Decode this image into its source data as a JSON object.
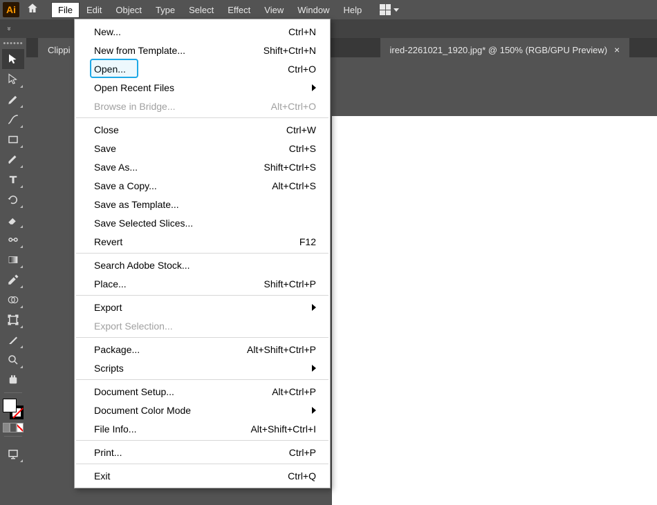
{
  "app_logo_text": "Ai",
  "menus": {
    "file": "File",
    "edit": "Edit",
    "object": "Object",
    "type": "Type",
    "select": "Select",
    "effect": "Effect",
    "view": "View",
    "window": "Window",
    "help": "Help"
  },
  "tab": {
    "title_left": "Clippi",
    "title_right": "ired-2261021_1920.jpg* @ 150% (RGB/GPU Preview)"
  },
  "file_menu": {
    "groups": [
      [
        {
          "label": "New...",
          "shortcut": "Ctrl+N",
          "sub": false
        },
        {
          "label": "New from Template...",
          "shortcut": "Shift+Ctrl+N",
          "sub": false
        },
        {
          "label": "Open...",
          "shortcut": "Ctrl+O",
          "sub": false,
          "highlight": true
        },
        {
          "label": "Open Recent Files",
          "shortcut": "",
          "sub": true
        },
        {
          "label": "Browse in Bridge...",
          "shortcut": "Alt+Ctrl+O",
          "sub": false,
          "disabled": true
        }
      ],
      [
        {
          "label": "Close",
          "shortcut": "Ctrl+W",
          "sub": false
        },
        {
          "label": "Save",
          "shortcut": "Ctrl+S",
          "sub": false
        },
        {
          "label": "Save As...",
          "shortcut": "Shift+Ctrl+S",
          "sub": false
        },
        {
          "label": "Save a Copy...",
          "shortcut": "Alt+Ctrl+S",
          "sub": false
        },
        {
          "label": "Save as Template...",
          "shortcut": "",
          "sub": false
        },
        {
          "label": "Save Selected Slices...",
          "shortcut": "",
          "sub": false
        },
        {
          "label": "Revert",
          "shortcut": "F12",
          "sub": false
        }
      ],
      [
        {
          "label": "Search Adobe Stock...",
          "shortcut": "",
          "sub": false
        },
        {
          "label": "Place...",
          "shortcut": "Shift+Ctrl+P",
          "sub": false
        }
      ],
      [
        {
          "label": "Export",
          "shortcut": "",
          "sub": true
        },
        {
          "label": "Export Selection...",
          "shortcut": "",
          "sub": false,
          "disabled": true
        }
      ],
      [
        {
          "label": "Package...",
          "shortcut": "Alt+Shift+Ctrl+P",
          "sub": false
        },
        {
          "label": "Scripts",
          "shortcut": "",
          "sub": true
        }
      ],
      [
        {
          "label": "Document Setup...",
          "shortcut": "Alt+Ctrl+P",
          "sub": false
        },
        {
          "label": "Document Color Mode",
          "shortcut": "",
          "sub": true
        },
        {
          "label": "File Info...",
          "shortcut": "Alt+Shift+Ctrl+I",
          "sub": false
        }
      ],
      [
        {
          "label": "Print...",
          "shortcut": "Ctrl+P",
          "sub": false
        }
      ],
      [
        {
          "label": "Exit",
          "shortcut": "Ctrl+Q",
          "sub": false
        }
      ]
    ]
  },
  "tools": [
    "selection-tool",
    "direct-selection-tool",
    "pen-tool",
    "curvature-tool",
    "rectangle-tool",
    "paintbrush-tool",
    "type-tool",
    "rotate-tool",
    "eraser-tool",
    "width-tool",
    "gradient-tool",
    "eyedropper-tool",
    "blend-tool",
    "artboard-tool",
    "slice-tool",
    "zoom-tool",
    "hand-tool"
  ]
}
